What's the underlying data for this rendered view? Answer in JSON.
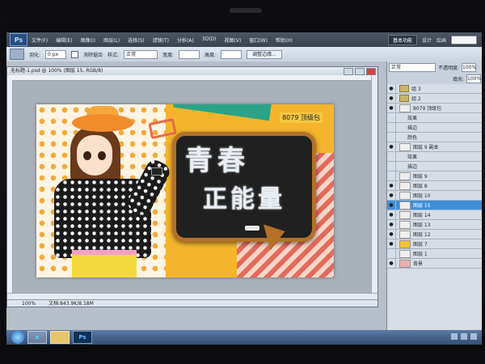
{
  "app": {
    "name": "Photoshop",
    "logo_text": "Ps"
  },
  "menubar": {
    "items": [
      "文件(F)",
      "编辑(E)",
      "图像(I)",
      "图层(L)",
      "选择(S)",
      "滤镜(T)",
      "分析(A)",
      "3D(D)",
      "视图(V)",
      "窗口(W)",
      "帮助(H)"
    ],
    "zoom": "100%",
    "workspace_button": "基本功能",
    "workspace_links": [
      "设计",
      "绘画"
    ]
  },
  "options_bar": {
    "feather_label": "羽化:",
    "feather_value": "0 px",
    "antialias_label": "消除锯齿",
    "style_label": "样式:",
    "style_value": "正常",
    "width_label": "宽度:",
    "height_label": "高度:",
    "refine_button": "调整边缘..."
  },
  "document": {
    "title": "无标题-1.psd @ 100% (图层 15, RGB/8)",
    "status": "文档:843.9K/8.18M",
    "zoom_status": "100%"
  },
  "artwork": {
    "headline_line1": "青春",
    "headline_line2": "正能量",
    "price_tag": "8079 顶级包"
  },
  "layers_panel": {
    "blend_mode": "正常",
    "opacity_label": "不透明度:",
    "opacity_value": "100%",
    "fill_label": "填充:",
    "fill_value": "100%",
    "layers": [
      {
        "name": "组 3",
        "type": "group"
      },
      {
        "name": "组 2",
        "type": "group"
      },
      {
        "name": "8079 顶级包",
        "type": "text"
      },
      {
        "name": "效果",
        "type": "effect"
      },
      {
        "name": "描边",
        "type": "effect"
      },
      {
        "name": "颜色",
        "type": "effect"
      },
      {
        "name": "图层 9 副本",
        "type": "layer"
      },
      {
        "name": "效果",
        "type": "effect"
      },
      {
        "name": "描边",
        "type": "effect"
      },
      {
        "name": "图层 9",
        "type": "layer"
      },
      {
        "name": "图层 8",
        "type": "layer"
      },
      {
        "name": "图层 10",
        "type": "layer"
      },
      {
        "name": "图层 15",
        "type": "layer",
        "selected": true
      },
      {
        "name": "图层 14",
        "type": "layer"
      },
      {
        "name": "图层 13",
        "type": "layer"
      },
      {
        "name": "图层 12",
        "type": "layer"
      },
      {
        "name": "图层 7",
        "type": "layer"
      },
      {
        "name": "图层 1",
        "type": "layer"
      },
      {
        "name": "背景",
        "type": "layer"
      }
    ]
  },
  "colors": {
    "selection": "#3f8fd8",
    "board_frame": "#b27127",
    "banner_bg": "#f4b52c"
  }
}
